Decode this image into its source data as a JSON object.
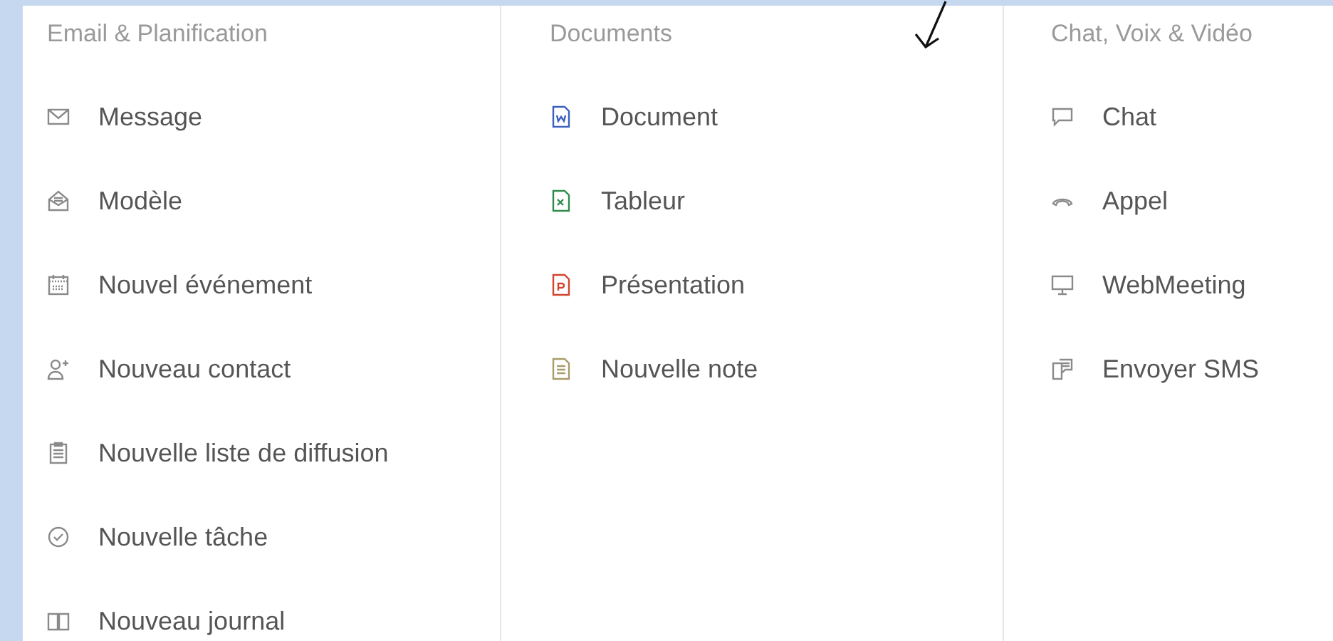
{
  "columns": [
    {
      "title": "Email & Planification",
      "items": [
        {
          "label": "Message",
          "kind": "mail"
        },
        {
          "label": "Modèle",
          "kind": "template"
        },
        {
          "label": "Nouvel événement",
          "kind": "calendar"
        },
        {
          "label": "Nouveau contact",
          "kind": "contact"
        },
        {
          "label": "Nouvelle liste de diffusion",
          "kind": "list"
        },
        {
          "label": "Nouvelle tâche",
          "kind": "task"
        },
        {
          "label": "Nouveau journal",
          "kind": "journal"
        }
      ]
    },
    {
      "title": "Documents",
      "items": [
        {
          "label": "Document",
          "kind": "word"
        },
        {
          "label": "Tableur",
          "kind": "sheet"
        },
        {
          "label": "Présentation",
          "kind": "slides"
        },
        {
          "label": "Nouvelle note",
          "kind": "note"
        }
      ]
    },
    {
      "title": "Chat, Voix & Vidéo",
      "items": [
        {
          "label": "Chat",
          "kind": "chat"
        },
        {
          "label": "Appel",
          "kind": "call"
        },
        {
          "label": "WebMeeting",
          "kind": "meeting"
        },
        {
          "label": "Envoyer SMS",
          "kind": "sms"
        }
      ]
    }
  ]
}
